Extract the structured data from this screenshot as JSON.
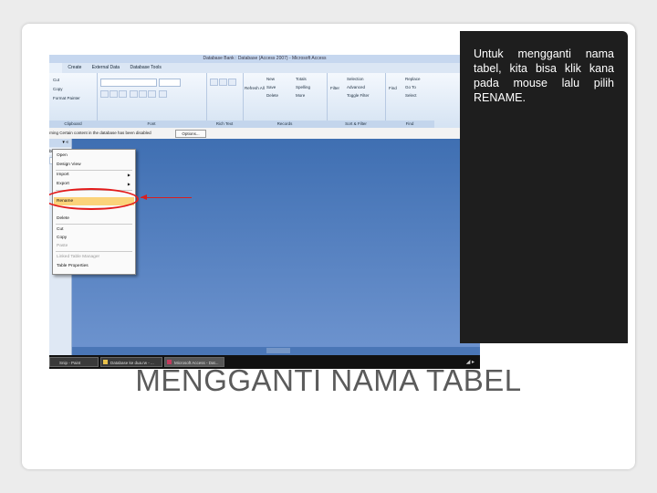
{
  "window": {
    "title": "Database Bank : Database (Access 2007) - Microsoft Access"
  },
  "ribbon": {
    "tabs": [
      "Create",
      "External Data",
      "Database Tools"
    ],
    "groups": [
      "Clipboard",
      "Font",
      "Rich Text",
      "Records",
      "Sort & Filter",
      "Find"
    ],
    "clipboard_items": [
      "Cut",
      "Copy",
      "Format Painter"
    ],
    "records_items": [
      "New",
      "Save",
      "Delete",
      "Totals",
      "Spelling",
      "More"
    ],
    "view_label": "Refresh All",
    "filter_label": "Filter",
    "sort_items": [
      "Selection",
      "Advanced",
      "Toggle Filter"
    ],
    "find_label": "Find",
    "find_items": [
      "Replace",
      "Go To",
      "Select"
    ]
  },
  "message_bar": {
    "text": "rning   Certain content in the database has been disabled",
    "options_label": "Options..."
  },
  "nav_pane": {
    "row_label": "ble"
  },
  "context_menu": {
    "items": [
      {
        "label": "Open",
        "submenu": false
      },
      {
        "label": "Design View",
        "submenu": false
      },
      {
        "label": "Import",
        "submenu": true
      },
      {
        "label": "Export",
        "submenu": true
      },
      {
        "label": "Rename",
        "submenu": false,
        "highlighted": true
      },
      {
        "label": "Delete",
        "submenu": false
      },
      {
        "label": "Cut",
        "submenu": false
      },
      {
        "label": "Copy",
        "submenu": false
      },
      {
        "label": "Paste",
        "submenu": false,
        "disabled": true
      },
      {
        "label": "Linked Table Manager",
        "submenu": false,
        "disabled": true
      },
      {
        "label": "Table Properties",
        "submenu": false
      }
    ]
  },
  "taskbar": {
    "items": [
      "Snip - Paint",
      "Database ke dua.rw - ...",
      "Microsoft Access - Dat..."
    ]
  },
  "annotation": {
    "color": "#e31b1b"
  },
  "note": {
    "text": "Untuk mengganti nama tabel, kita bisa klik kana pada mouse lalu pilih RENAME."
  },
  "slide": {
    "title": "MENGGANTI NAMA TABEL"
  }
}
